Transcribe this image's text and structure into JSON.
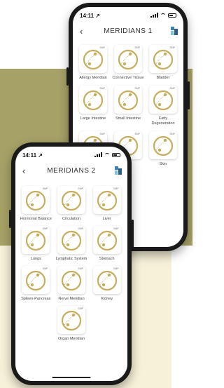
{
  "colors": {
    "olive": "#a6a167",
    "cream": "#f6f1d8",
    "tile_gold": "#c4ae5f"
  },
  "phone_back": {
    "status": {
      "time": "14:11 ↗"
    },
    "nav": {
      "back_icon": "‹",
      "title": "MERIDIANS 1"
    },
    "badge": "SMP",
    "items": [
      {
        "label": "Allergy Meridian"
      },
      {
        "label": "Connective Tissue"
      },
      {
        "label": "Bladder"
      },
      {
        "label": "Large Intestine"
      },
      {
        "label": "Small Intestine"
      },
      {
        "label": "Fatty Degeneration"
      },
      {
        "label": ""
      },
      {
        "label": ""
      },
      {
        "label": "Skin"
      },
      {
        "label": ""
      }
    ]
  },
  "phone_front": {
    "status": {
      "time": "14:11 ↗"
    },
    "nav": {
      "back_icon": "‹",
      "title": "MERIDIANS 2"
    },
    "badge": "SMP",
    "items": [
      {
        "label": "Hormonal Balance"
      },
      {
        "label": "Circulation"
      },
      {
        "label": "Liver"
      },
      {
        "label": "Lungs"
      },
      {
        "label": "Lymphatic System"
      },
      {
        "label": "Stomach"
      },
      {
        "label": "Spleen-Pancreas"
      },
      {
        "label": "Nerve Meridian"
      },
      {
        "label": "Kidney"
      },
      {
        "label": "Organ Meridian"
      }
    ]
  }
}
